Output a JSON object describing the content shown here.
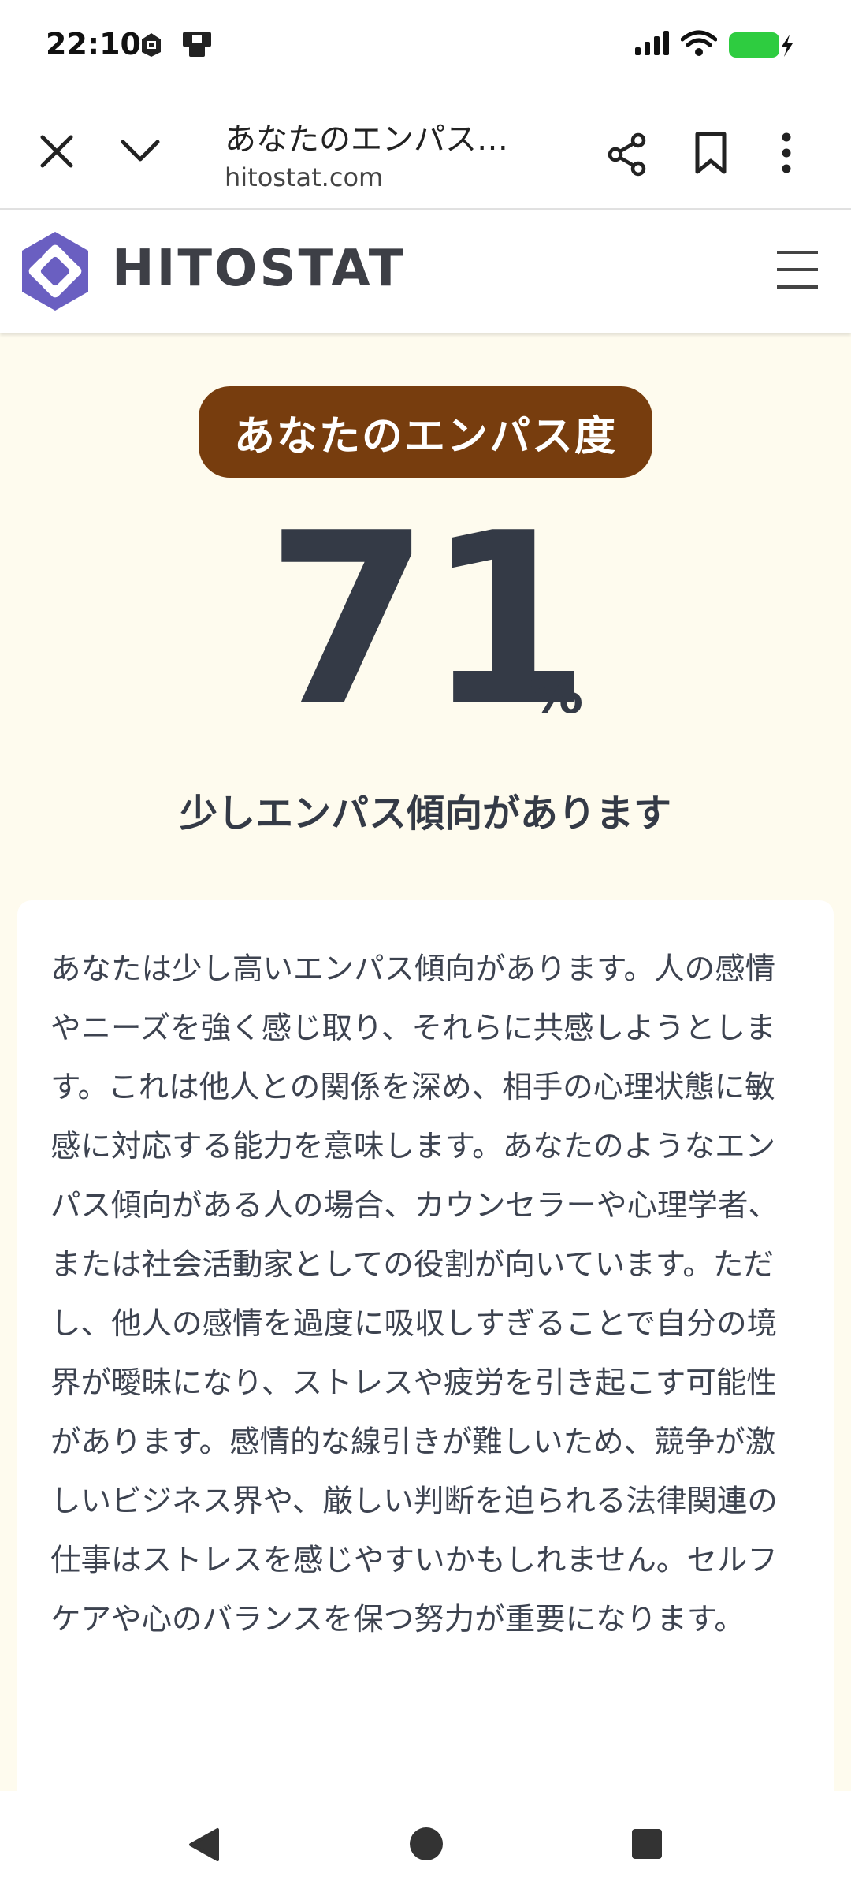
{
  "status_bar": {
    "time": "22:10",
    "icons": [
      "notification-app-icon",
      "notification-app-icon-2",
      "signal-icon",
      "wifi-icon",
      "battery-charging-icon"
    ],
    "battery_color": "#2ecc40"
  },
  "browser": {
    "tab_title": "あなたのエンパス…",
    "url": "hitostat.com"
  },
  "site": {
    "brand": "HITOSTAT",
    "logo_color": "#6a5fc1"
  },
  "result": {
    "heading": "あなたのエンパス度",
    "score": "71",
    "unit": "%",
    "verdict": "少しエンパス傾向があります",
    "description": "あなたは少し高いエンパス傾向があります。人の感情やニーズを強く感じ取り、それらに共感しようとします。これは他人との関係を深め、相手の心理状態に敏感に対応する能力を意味します。あなたのようなエンパス傾向がある人の場合、カウンセラーや心理学者、または社会活動家としての役割が向いています。ただし、他人の感情を過度に吸収しすぎることで自分の境界が曖昧になり、ストレスや疲労を引き起こす可能性があります。感情的な線引きが難しいため、競争が激しいビジネス界や、厳しい判断を迫られる法律関連の仕事はストレスを感じやすいかもしれません。セルフケアや心のバランスを保つ努力が重要になります。",
    "pill_color": "#773d0e",
    "background_color": "#fefbee"
  }
}
